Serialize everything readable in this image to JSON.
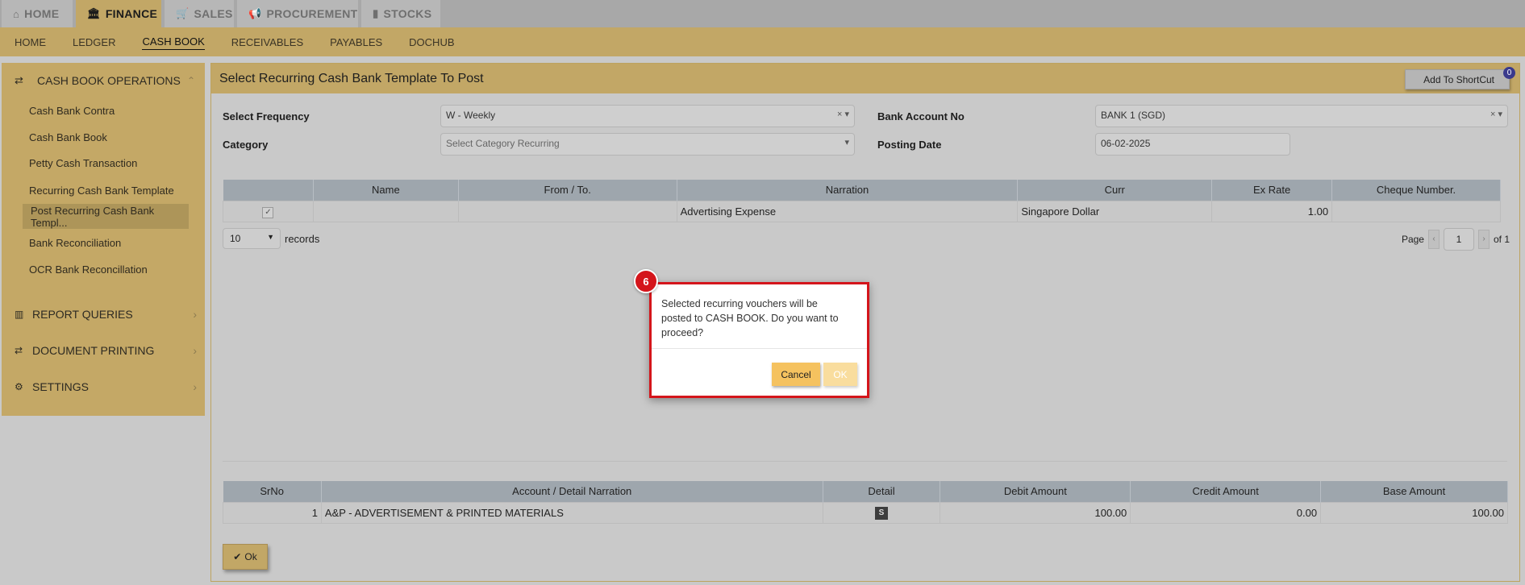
{
  "top_tabs": [
    {
      "label": "HOME",
      "icon": "home-icon"
    },
    {
      "label": "FINANCE",
      "icon": "bank-icon"
    },
    {
      "label": "SALES",
      "icon": "cart-icon"
    },
    {
      "label": "PROCUREMENT",
      "icon": "megaphone-icon"
    },
    {
      "label": "STOCKS",
      "icon": "bar-chart-icon"
    }
  ],
  "subnav": [
    "HOME",
    "LEDGER",
    "CASH BOOK",
    "RECEIVABLES",
    "PAYABLES",
    "DOCHUB"
  ],
  "sidebar": {
    "heading": "CASH BOOK OPERATIONS",
    "items": [
      "Cash Bank Contra",
      "Cash Bank Book",
      "Petty Cash Transaction",
      "Recurring Cash Bank Template",
      "Post Recurring Cash Bank Templ...",
      "Bank Reconciliation",
      "OCR Bank Reconcillation"
    ],
    "sections": [
      "REPORT QUERIES",
      "DOCUMENT PRINTING",
      "SETTINGS"
    ]
  },
  "panel": {
    "title": "Select Recurring Cash Bank Template To Post",
    "shortcut_label": "Add To ShortCut",
    "shortcut_count": "0"
  },
  "form": {
    "frequency_label": "Select Frequency",
    "frequency_value": "W - Weekly",
    "category_label": "Category",
    "category_placeholder": "Select Category Recurring",
    "bank_label": "Bank Account No",
    "bank_value": "BANK 1 (SGD)",
    "date_label": "Posting Date",
    "date_value": "06-02-2025"
  },
  "template_table": {
    "headers": [
      "",
      "Name",
      "From / To.",
      "Narration",
      "Curr",
      "Ex Rate",
      "Cheque Number."
    ],
    "row": {
      "name": "",
      "from_to": "",
      "narration": "Advertising Expense",
      "curr": "Singapore Dollar",
      "ex_rate": "1.00",
      "cheque": ""
    }
  },
  "records": {
    "value": "10",
    "label": "records"
  },
  "pager": {
    "page_label": "Page",
    "page": "1",
    "of_label": "of 1"
  },
  "detail_table": {
    "headers": [
      "SrNo",
      "Account / Detail Narration",
      "Detail",
      "Debit Amount",
      "Credit Amount",
      "Base Amount"
    ],
    "row": {
      "srno": "1",
      "account": "A&P - ADVERTISEMENT & PRINTED MATERIALS",
      "detail": "S",
      "debit": "100.00",
      "credit": "0.00",
      "base": "100.00"
    }
  },
  "ok_button": "Ok",
  "modal": {
    "message": "Selected recurring vouchers will be posted to CASH BOOK. Do you want to proceed?",
    "cancel": "Cancel",
    "ok": "OK",
    "step": "6"
  },
  "colors": {
    "accent": "#c2a766",
    "modal_border": "#d4151b",
    "cancel_button": "#f5c25f"
  }
}
